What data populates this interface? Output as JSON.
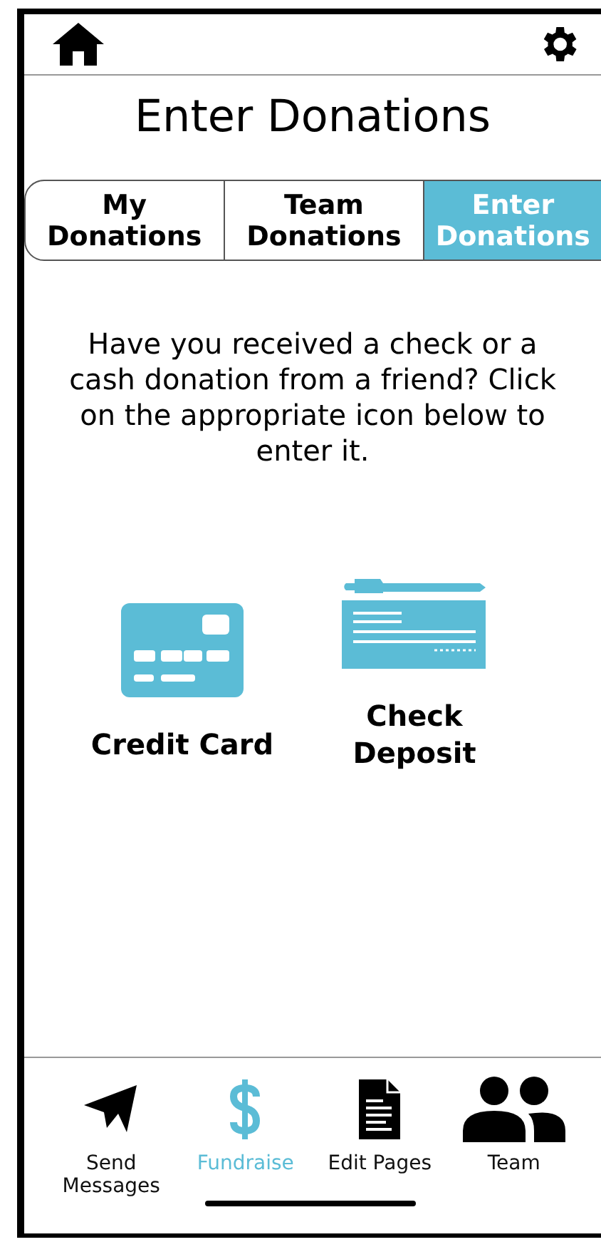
{
  "header": {
    "title": "Enter Donations"
  },
  "tabs": [
    {
      "label": "My Donations",
      "selected": false
    },
    {
      "label": "Team Donations",
      "selected": false
    },
    {
      "label": "Enter Donations",
      "selected": true
    }
  ],
  "intro": "Have you received a check or a cash donation from a friend? Click on the appropriate icon below to enter it.",
  "options": [
    {
      "kind": "card",
      "label": "Credit Card"
    },
    {
      "kind": "check",
      "label": "Check Deposit"
    }
  ],
  "bottom_nav": [
    {
      "kind": "send",
      "label": "Send Messages",
      "selected": false
    },
    {
      "kind": "fundraise",
      "label": "Fundraise",
      "selected": true
    },
    {
      "kind": "pages",
      "label": "Edit Pages",
      "selected": false
    },
    {
      "kind": "team",
      "label": "Team",
      "selected": false
    }
  ]
}
